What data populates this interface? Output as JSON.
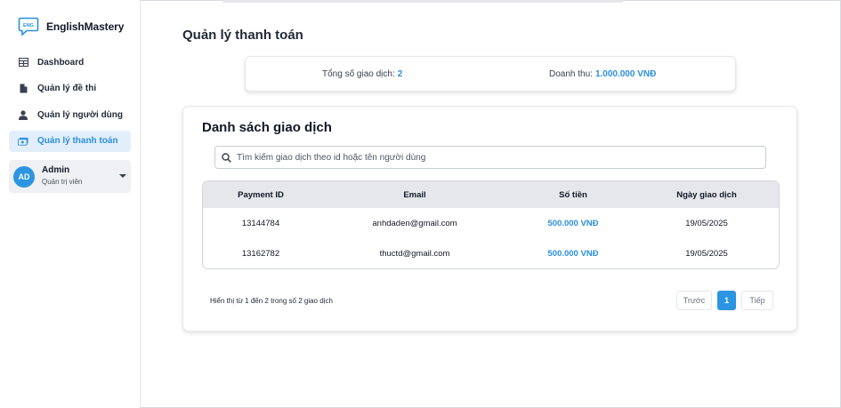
{
  "app": {
    "brand_name": "EnglishMastery",
    "logo_text": "ENG"
  },
  "sidebar": {
    "items": [
      {
        "label": "Dashboard",
        "icon": "table-grid-icon",
        "active": false
      },
      {
        "label": "Quản lý đề thi",
        "icon": "document-icon",
        "active": false
      },
      {
        "label": "Quản lý người dùng",
        "icon": "user-icon",
        "active": false
      },
      {
        "label": "Quản lý thanh toán",
        "icon": "money-bill-icon",
        "active": true
      }
    ],
    "user": {
      "avatar_initials": "AD",
      "name": "Admin",
      "role": "Quản trị viên"
    }
  },
  "main": {
    "page_title": "Quản lý thanh toán",
    "stats": {
      "total_label": "Tổng số giao dịch:",
      "total_value": "2",
      "revenue_label": "Doanh thu:",
      "revenue_value": "1.000.000 VNĐ"
    },
    "card": {
      "title": "Danh sách giao dịch",
      "search_placeholder": "Tìm kiếm giao dịch theo id hoặc tên người dùng",
      "columns": [
        "Payment ID",
        "Email",
        "Số tiền",
        "Ngày giao dịch"
      ],
      "rows": [
        [
          "13144784",
          "anhdaden@gmail.com",
          "500.000 VNĐ",
          "19/05/2025"
        ],
        [
          "13162782",
          "thuctd@gmail.com",
          "500.000 VNĐ",
          "19/05/2025"
        ]
      ],
      "footer_info": "Hiển thị từ 1 đến 2 trong số 2 giao dịch",
      "pagination": {
        "prev_label": "Trước",
        "current_page": "1",
        "next_label": "Tiếp"
      }
    }
  },
  "colors": {
    "accent": "#2b8fe0",
    "active_bg": "#e3eefb",
    "avatar_bg": "#2b95e2"
  }
}
